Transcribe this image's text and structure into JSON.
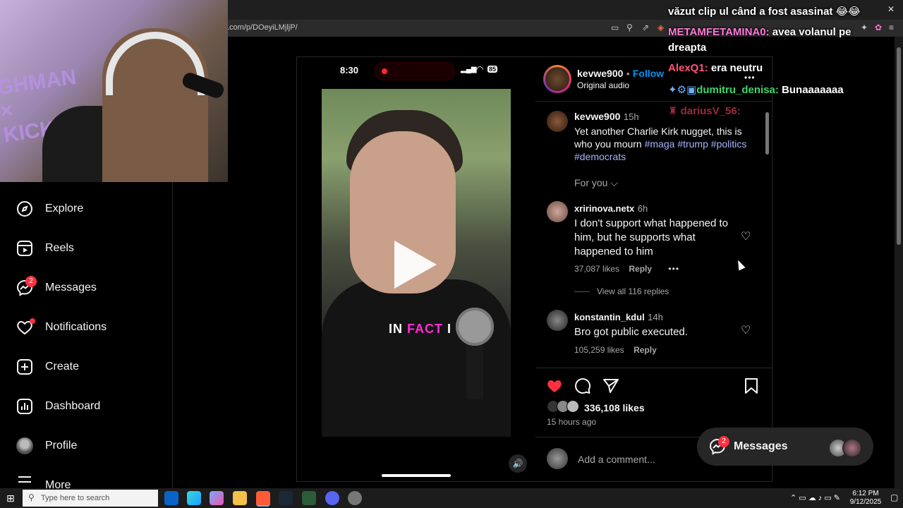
{
  "browser": {
    "url": ".com/p/DOeyiLMjljP/",
    "close_glyph": "✕"
  },
  "webcam": {
    "bg_line1": "GHMAN",
    "bg_line2": "×",
    "bg_line3": "KICK"
  },
  "sidebar": {
    "items": [
      {
        "label": "Explore",
        "icon": "compass-icon"
      },
      {
        "label": "Reels",
        "icon": "reels-icon"
      },
      {
        "label": "Messages",
        "icon": "messenger-icon",
        "badge": "2"
      },
      {
        "label": "Notifications",
        "icon": "heart-icon"
      },
      {
        "label": "Create",
        "icon": "plus-square-icon"
      },
      {
        "label": "Dashboard",
        "icon": "chart-icon"
      },
      {
        "label": "Profile",
        "icon": "profile-avatar"
      },
      {
        "label": "More",
        "icon": "menu-icon"
      }
    ]
  },
  "phone": {
    "time": "8:30",
    "battery": "85"
  },
  "video": {
    "caption_pre": "IN ",
    "caption_highlight": "FACT",
    "caption_post": " I"
  },
  "post": {
    "author": "kevwe900",
    "follow": "Follow",
    "audio": "Original audio",
    "dot": "•",
    "more": "•••",
    "caption_author": "kevwe900",
    "caption_time": "15h",
    "caption_text": "Yet another Charlie Kirk nugget, this is who you mourn ",
    "hashtags": [
      "#maga",
      "#trump",
      "#politics",
      "#democrats"
    ],
    "sort": "For you",
    "likes": "336,108 likes",
    "posted": "15 hours ago",
    "add_comment": "Add a comment..."
  },
  "comments": [
    {
      "user": "xririnova.netx",
      "time": "6h",
      "text": "I don't support what happened to him, but he supports what happened to him",
      "likes": "37,087 likes",
      "reply": "Reply",
      "more": "•••",
      "view_replies": "View all 116 replies"
    },
    {
      "user": "konstantin_kdul",
      "time": "14h",
      "text": "Bro got public executed.",
      "likes": "105,259 likes",
      "reply": "Reply"
    }
  ],
  "floating_messages": {
    "label": "Messages",
    "badge": "2"
  },
  "chat": [
    {
      "user": "",
      "text": "văzut clip ul când a fost asasinat 😂😂"
    },
    {
      "user": "METAMFETAMINA0:",
      "text": " avea volanul pe",
      "user_color": "#ff7ad9"
    },
    {
      "user": "",
      "text": "dreapta"
    },
    {
      "user": "AlexQ1:",
      "text": " era neutru",
      "user_color": "#ff5577"
    },
    {
      "user": "dumitru_denisa:",
      "text": " Bunaaaaaaa",
      "user_color": "#3bd66b"
    },
    {
      "user": "dariusV_56:",
      "text": "",
      "user_color": "#c0384a"
    }
  ],
  "taskbar": {
    "search_placeholder": "Type here to search",
    "time": "6:12 PM",
    "date": "9/12/2025"
  },
  "colors": {
    "like_red": "#ff3040",
    "follow_blue": "#0095f6",
    "hashtag": "#a5b4fc",
    "caption_pink": "#ff2bd6"
  }
}
